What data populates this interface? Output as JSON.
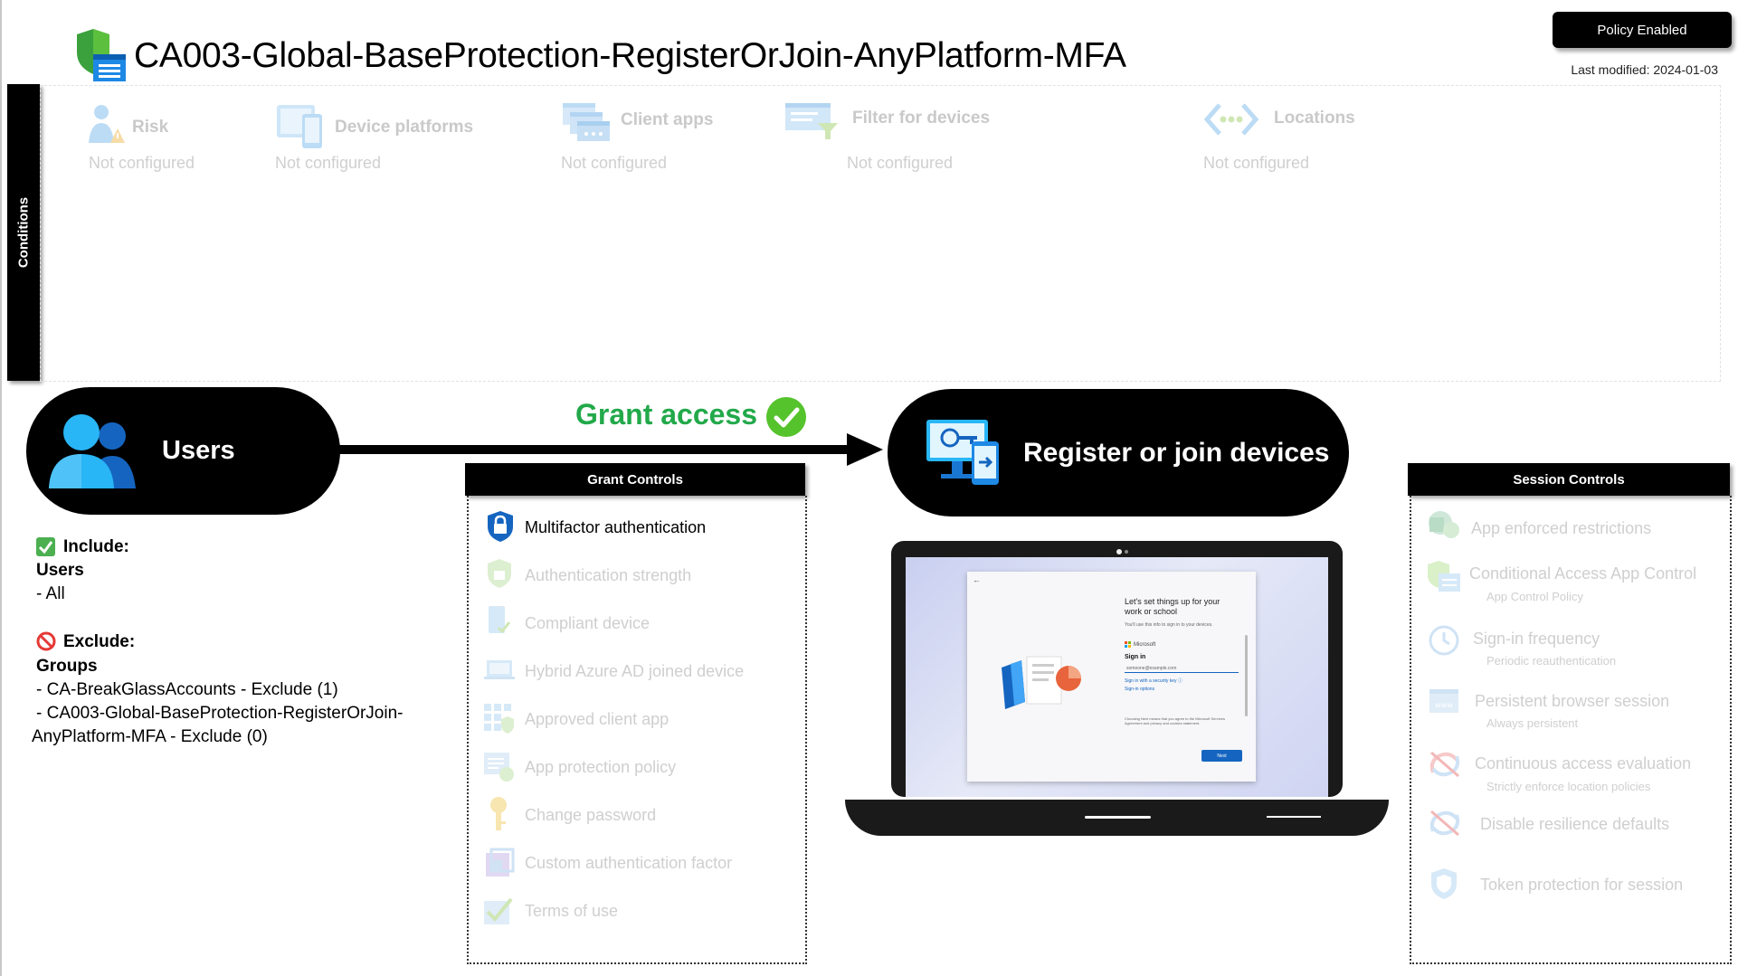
{
  "header": {
    "title": "CA003-Global-BaseProtection-RegisterOrJoin-AnyPlatform-MFA",
    "status_badge": "Policy Enabled",
    "last_modified": "Last modified: 2024-01-03"
  },
  "conditions": {
    "tab_label": "Conditions",
    "items": [
      {
        "label": "Risk",
        "value": "Not configured",
        "icon": "risk-user-icon"
      },
      {
        "label": "Device platforms",
        "value": "Not configured",
        "icon": "device-platforms-icon"
      },
      {
        "label": "Client apps",
        "value": "Not configured",
        "icon": "client-apps-icon"
      },
      {
        "label": "Filter for devices",
        "value": "Not configured",
        "icon": "filter-devices-icon"
      },
      {
        "label": "Locations",
        "value": "Not configured",
        "icon": "locations-icon"
      }
    ]
  },
  "users": {
    "label": "Users",
    "include_title": "Include:",
    "include_group": "Users",
    "include_items": [
      "- All"
    ],
    "exclude_title": "Exclude:",
    "exclude_group": "Groups",
    "exclude_items": [
      "- CA-BreakGlassAccounts - Exclude (1)",
      "- CA003-Global-BaseProtection-RegisterOrJoin-",
      "AnyPlatform-MFA - Exclude (0)"
    ]
  },
  "flow": {
    "grant_label": "Grant access",
    "target_label": "Register or join devices"
  },
  "grant_controls": {
    "header": "Grant Controls",
    "items": [
      {
        "label": "Multifactor authentication",
        "active": true
      },
      {
        "label": "Authentication strength",
        "active": false
      },
      {
        "label": "Compliant device",
        "active": false
      },
      {
        "label": "Hybrid Azure AD joined device",
        "active": false
      },
      {
        "label": "Approved client app",
        "active": false
      },
      {
        "label": "App protection policy",
        "active": false
      },
      {
        "label": "Change password",
        "active": false
      },
      {
        "label": "Custom authentication factor",
        "active": false
      },
      {
        "label": "Terms of use",
        "active": false
      }
    ]
  },
  "session_controls": {
    "header": "Session Controls",
    "items": [
      {
        "label": "App enforced restrictions",
        "sub": ""
      },
      {
        "label": "Conditional Access App Control",
        "sub": "App Control Policy"
      },
      {
        "label": "Sign-in frequency",
        "sub": "Periodic reauthentication"
      },
      {
        "label": "Persistent browser session",
        "sub": "Always persistent"
      },
      {
        "label": "Continuous access evaluation",
        "sub": "Strictly enforce location policies"
      },
      {
        "label": "Disable resilience defaults",
        "sub": ""
      },
      {
        "label": "Token protection for session",
        "sub": ""
      }
    ]
  },
  "laptop_dialog": {
    "heading_line1": "Let's set things up for your",
    "heading_line2": "work or school",
    "subtext": "You'll use this info to sign in to your devices.",
    "brand": "Microsoft",
    "sign_in": "Sign in",
    "email_placeholder": "someone@example.com",
    "security_key": "Sign in with a security key ⓘ",
    "options": "Sign-in options",
    "legal": "Choosing Next means that you agree to the Microsoft Services Agreement and privacy and cookies statement.",
    "next_button": "Next"
  },
  "colors": {
    "accent_green": "#22a94a",
    "icon_blue": "#1e88e5",
    "disabled_gray": "#cfcfcf"
  }
}
